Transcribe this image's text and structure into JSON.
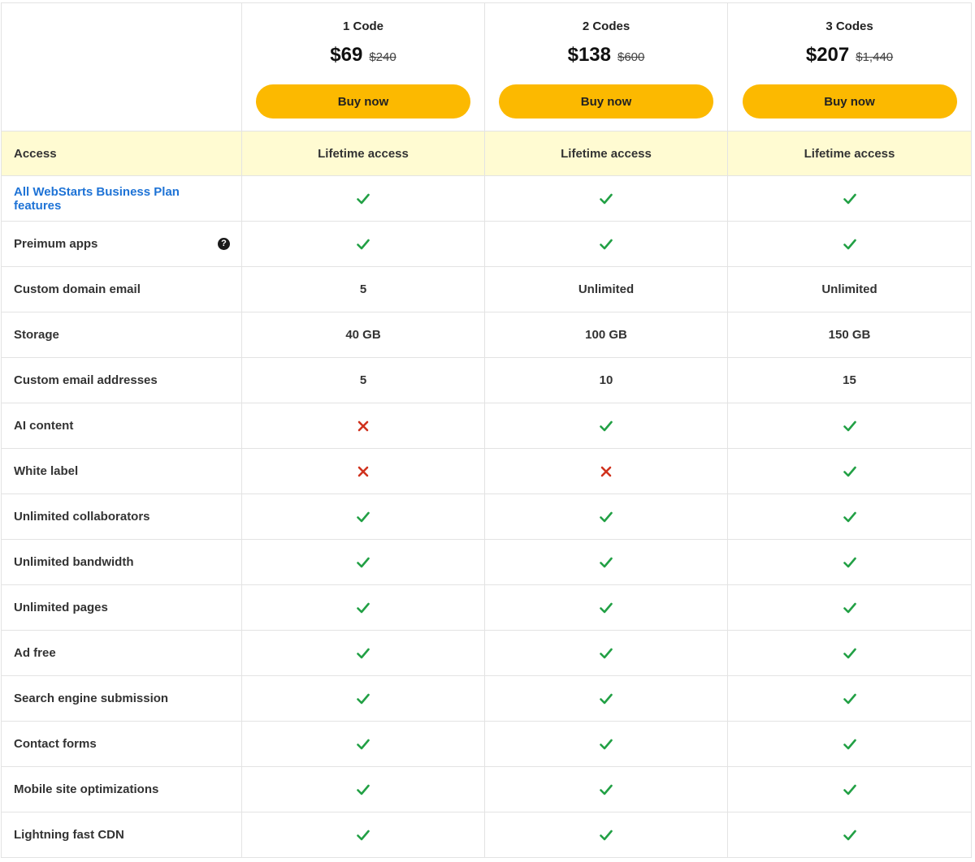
{
  "plans": [
    {
      "name": "1 Code",
      "price": "$69",
      "old_price": "$240",
      "button_label": "Buy now"
    },
    {
      "name": "2 Codes",
      "price": "$138",
      "old_price": "$600",
      "button_label": "Buy now"
    },
    {
      "name": "3 Codes",
      "price": "$207",
      "old_price": "$1,440",
      "button_label": "Buy now"
    }
  ],
  "features": [
    {
      "label": "Access",
      "values": [
        "Lifetime access",
        "Lifetime access",
        "Lifetime access"
      ]
    },
    {
      "label": "All WebStarts Business Plan features",
      "link": true,
      "values": [
        "check",
        "check",
        "check"
      ]
    },
    {
      "label": "Preimum apps",
      "help_icon": "question-circle-icon",
      "values": [
        "check",
        "check",
        "check"
      ]
    },
    {
      "label": "Custom domain email",
      "values": [
        "5",
        "Unlimited",
        "Unlimited"
      ]
    },
    {
      "label": "Storage",
      "values": [
        "40 GB",
        "100 GB",
        "150 GB"
      ]
    },
    {
      "label": "Custom email addresses",
      "values": [
        "5",
        "10",
        "15"
      ]
    },
    {
      "label": "AI content",
      "values": [
        "cross",
        "check",
        "check"
      ]
    },
    {
      "label": "White label",
      "values": [
        "cross",
        "cross",
        "check"
      ]
    },
    {
      "label": "Unlimited collaborators",
      "values": [
        "check",
        "check",
        "check"
      ]
    },
    {
      "label": "Unlimited bandwidth",
      "values": [
        "check",
        "check",
        "check"
      ]
    },
    {
      "label": "Unlimited pages",
      "values": [
        "check",
        "check",
        "check"
      ]
    },
    {
      "label": "Ad free",
      "values": [
        "check",
        "check",
        "check"
      ]
    },
    {
      "label": "Search engine submission",
      "values": [
        "check",
        "check",
        "check"
      ]
    },
    {
      "label": "Contact forms",
      "values": [
        "check",
        "check",
        "check"
      ]
    },
    {
      "label": "Mobile site optimizations",
      "values": [
        "check",
        "check",
        "check"
      ]
    },
    {
      "label": "Lightning fast CDN",
      "values": [
        "check",
        "check",
        "check"
      ]
    }
  ],
  "help_icon_glyph": "?",
  "colors": {
    "accent_button": "#fcb900",
    "access_row_bg": "#fffbd2",
    "link_text": "#1e73d6",
    "check": "#22a045",
    "cross": "#d0321e"
  }
}
